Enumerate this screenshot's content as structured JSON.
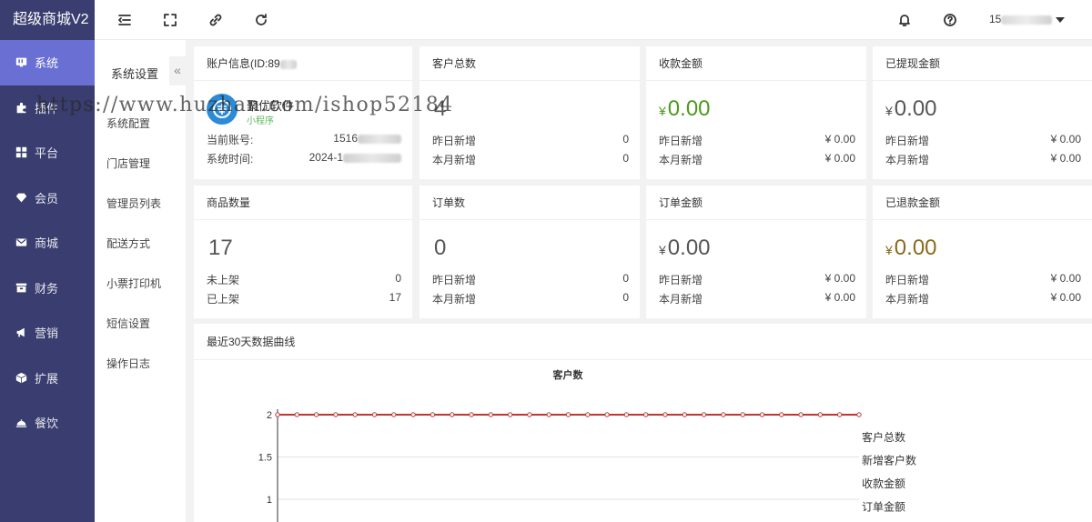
{
  "app": {
    "title": "超级商城V2"
  },
  "sidebar": {
    "items": [
      {
        "label": "系统",
        "icon": "monitor-icon",
        "active": true
      },
      {
        "label": "插件",
        "icon": "puzzle-icon",
        "active": false
      },
      {
        "label": "平台",
        "icon": "grid-icon",
        "active": false
      },
      {
        "label": "会员",
        "icon": "diamond-icon",
        "active": false
      },
      {
        "label": "商城",
        "icon": "mail-icon",
        "active": false
      },
      {
        "label": "财务",
        "icon": "wallet-icon",
        "active": false
      },
      {
        "label": "营销",
        "icon": "megaphone-icon",
        "active": false
      },
      {
        "label": "扩展",
        "icon": "cube-icon",
        "active": false
      },
      {
        "label": "餐饮",
        "icon": "cloche-icon",
        "active": false
      }
    ]
  },
  "topbar": {
    "icons": [
      "menu-fold-icon",
      "fullscreen-icon",
      "link-icon",
      "refresh-icon",
      "bell-icon",
      "help-icon"
    ],
    "account_prefix": "15"
  },
  "subnav": {
    "title": "系统设置",
    "collapse_glyph": "«",
    "items": [
      "系统配置",
      "门店管理",
      "管理员列表",
      "配送方式",
      "小票打印机",
      "短信设置",
      "操作日志"
    ]
  },
  "account_card": {
    "title": "账户信息(ID:89",
    "brand_name": "聚优软件",
    "brand_tag": "小程序",
    "account_label": "当前账号:",
    "account_value": "1516",
    "time_label": "系统时间:",
    "time_value": "2024-1"
  },
  "stats": [
    {
      "title": "客户总数",
      "value": "4",
      "currency": "",
      "rows": [
        {
          "label": "昨日新增",
          "value": "0"
        },
        {
          "label": "本月新增",
          "value": "0"
        }
      ]
    },
    {
      "title": "收款金额",
      "value": "0.00",
      "currency": "¥",
      "rows": [
        {
          "label": "昨日新增",
          "value": "¥ 0.00"
        },
        {
          "label": "本月新增",
          "value": "¥ 0.00"
        }
      ]
    },
    {
      "title": "已提现金额",
      "value": "0.00",
      "currency": "¥",
      "rows": [
        {
          "label": "昨日新增",
          "value": "¥ 0.00"
        },
        {
          "label": "本月新增",
          "value": "¥ 0.00"
        }
      ]
    },
    {
      "title": "商品数量",
      "value": "17",
      "currency": "",
      "rows": [
        {
          "label": "未上架",
          "value": "0"
        },
        {
          "label": "已上架",
          "value": "17"
        }
      ]
    },
    {
      "title": "订单数",
      "value": "0",
      "currency": "",
      "rows": [
        {
          "label": "昨日新增",
          "value": "0"
        },
        {
          "label": "本月新增",
          "value": "0"
        }
      ]
    },
    {
      "title": "订单金额",
      "value": "0.00",
      "currency": "¥",
      "rows": [
        {
          "label": "昨日新增",
          "value": "¥ 0.00"
        },
        {
          "label": "本月新增",
          "value": "¥ 0.00"
        }
      ]
    },
    {
      "title": "已退款金额",
      "value": "0.00",
      "currency": "¥",
      "rows": [
        {
          "label": "昨日新增",
          "value": "¥ 0.00"
        },
        {
          "label": "本月新增",
          "value": "¥ 0.00"
        }
      ]
    }
  ],
  "colors": {
    "sidebar": "#393d6f",
    "active": "#6a6fd4",
    "green": "#4c9a1c",
    "olive": "#8a6a1c",
    "line": "#c23531"
  },
  "chart_section": {
    "title": "最近30天数据曲线"
  },
  "chart_data": {
    "type": "line",
    "title": "客户数",
    "y_ticks": [
      "2",
      "1.5",
      "1"
    ],
    "ylim": [
      0,
      2
    ],
    "grid": true,
    "legend_placement": "right",
    "series": [
      {
        "name": "客户总数",
        "values": [
          2,
          2,
          2,
          2,
          2,
          2,
          2,
          2,
          2,
          2,
          2,
          2,
          2,
          2,
          2,
          2,
          2,
          2,
          2,
          2,
          2,
          2,
          2,
          2,
          2,
          2,
          2,
          2,
          2,
          2,
          2
        ]
      },
      {
        "name": "新增客户数",
        "values": []
      },
      {
        "name": "收款金额",
        "values": []
      },
      {
        "name": "订单金额",
        "values": []
      }
    ]
  },
  "watermark": "https://www.huzhan.com/ishop52184"
}
